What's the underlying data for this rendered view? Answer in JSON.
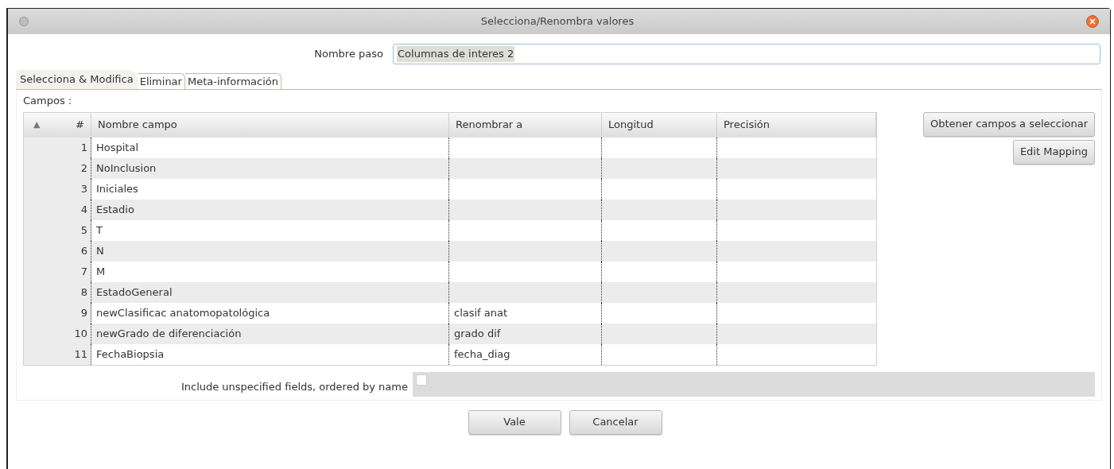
{
  "window": {
    "title": "Selecciona/Renombra valores"
  },
  "step_name": {
    "label": "Nombre paso",
    "value": "Columnas de interes 2"
  },
  "tabs": [
    {
      "label": "Selecciona & Modifica",
      "selected": true
    },
    {
      "label": "Eliminar",
      "selected": false
    },
    {
      "label": "Meta-información",
      "selected": false
    }
  ],
  "fields_label": "Campos :",
  "table": {
    "sort_indicator": "▲",
    "columns": [
      "#",
      "Nombre campo",
      "Renombrar a",
      "Longitud",
      "Precisión"
    ],
    "rows": [
      {
        "number": "1",
        "name": "Hospital"
      },
      {
        "number": "2",
        "name": "NoInclusion"
      },
      {
        "number": "3",
        "name": "Iniciales"
      },
      {
        "number": "4",
        "name": "Estadio"
      },
      {
        "number": "5",
        "name": "T"
      },
      {
        "number": "6",
        "name": "N"
      },
      {
        "number": "7",
        "name": "M"
      },
      {
        "number": "8",
        "name": "EstadoGeneral"
      },
      {
        "number": "9",
        "name": "newClasificac anatomopatológica",
        "rename_to": "clasif anat"
      },
      {
        "number": "10",
        "name": "newGrado de diferenciación",
        "rename_to": "grado dif"
      },
      {
        "number": "11",
        "name": "FechaBiopsia",
        "rename_to": "fecha_diag"
      }
    ]
  },
  "side_buttons": [
    "Obtener campos a seleccionar",
    "Edit Mapping"
  ],
  "include_unspecified": {
    "label": "Include unspecified fields, ordered by name",
    "checked": false
  },
  "buttons": [
    "Vale",
    "Cancelar"
  ]
}
